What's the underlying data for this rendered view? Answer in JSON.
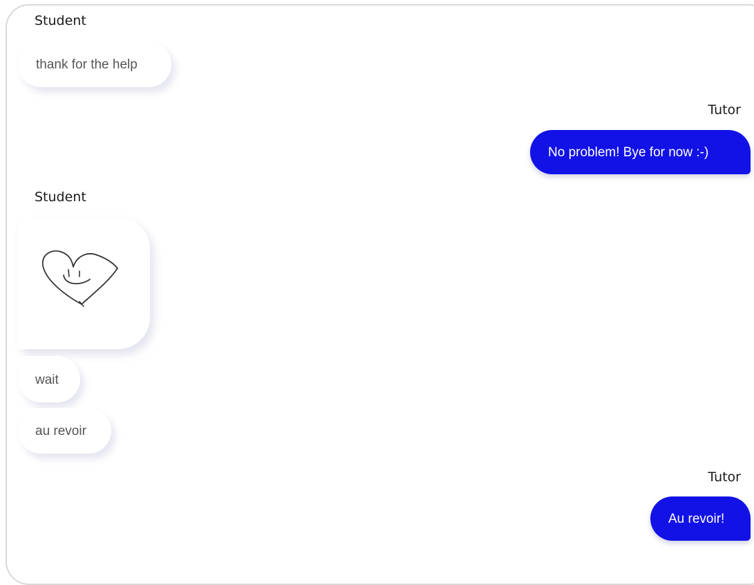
{
  "colors": {
    "tutor_bubble": "#1212e6",
    "student_bubble": "#ffffff",
    "student_text": "#555555",
    "tutor_text": "#ffffff"
  },
  "messages": [
    {
      "sender": "Student",
      "text": "thank for the help"
    },
    {
      "sender": "Tutor",
      "text": "No problem! Bye for now :-)"
    },
    {
      "sender": "Student",
      "text": "wait"
    },
    {
      "sender": "Student",
      "text": "au revoir"
    },
    {
      "sender": "Tutor",
      "text": "Au revoir!"
    }
  ],
  "attachments": [
    {
      "sender": "Student",
      "icon": "hand-drawn-smiling-heart"
    }
  ]
}
